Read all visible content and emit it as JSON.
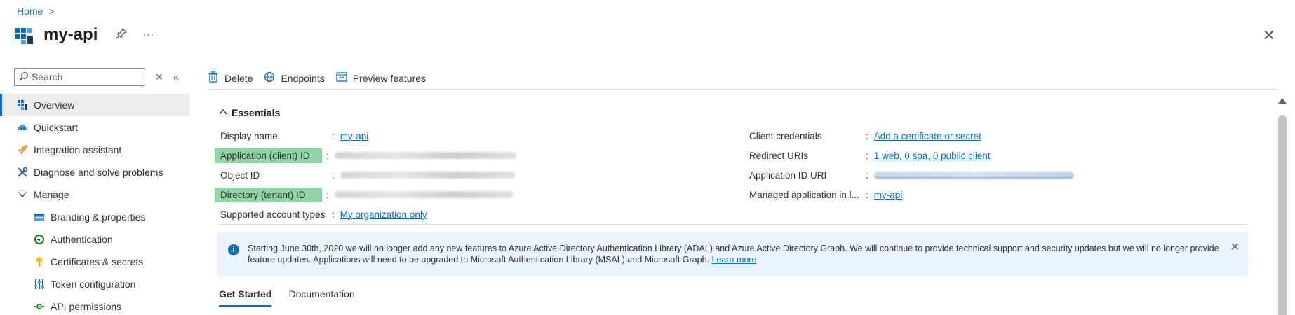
{
  "breadcrumb": {
    "home": "Home",
    "separator": ">"
  },
  "header": {
    "title": "my-api",
    "pin_icon": "pin-icon",
    "more": "···",
    "close": "✕"
  },
  "sidebar": {
    "search_placeholder": "Search",
    "clear_glyph": "✕",
    "collapse_glyph": "«",
    "items": [
      {
        "label": "Overview",
        "icon": "grid-icon"
      },
      {
        "label": "Quickstart",
        "icon": "cloud-icon"
      },
      {
        "label": "Integration assistant",
        "icon": "rocket-icon"
      },
      {
        "label": "Diagnose and solve problems",
        "icon": "wrench-icon"
      },
      {
        "label": "Manage",
        "icon": "chevron-down-icon"
      },
      {
        "label": "Branding & properties",
        "icon": "branding-icon"
      },
      {
        "label": "Authentication",
        "icon": "auth-icon"
      },
      {
        "label": "Certificates & secrets",
        "icon": "key-icon"
      },
      {
        "label": "Token configuration",
        "icon": "token-icon"
      },
      {
        "label": "API permissions",
        "icon": "permissions-icon"
      }
    ]
  },
  "toolbar": {
    "delete": "Delete",
    "endpoints": "Endpoints",
    "preview": "Preview features"
  },
  "essentials": {
    "title": "Essentials",
    "left": {
      "display_name_label": "Display name",
      "display_name_value": "my-api",
      "app_id_label": "Application (client) ID",
      "object_id_label": "Object ID",
      "directory_id_label": "Directory (tenant) ID",
      "supported_label": "Supported account types",
      "supported_value": "My organization only"
    },
    "right": {
      "client_cred_label": "Client credentials",
      "client_cred_value": "Add a certificate or secret",
      "redirect_label": "Redirect URIs",
      "redirect_value": "1 web, 0 spa, 0 public client",
      "app_id_uri_label": "Application ID URI",
      "managed_label": "Managed application in l...",
      "managed_value": "my-api"
    },
    "colon": ":"
  },
  "info": {
    "text": "Starting June 30th, 2020 we will no longer add any new features to Azure Active Directory Authentication Library (ADAL) and Azure Active Directory Graph. We will continue to provide technical support and security updates but we will no longer provide feature updates. Applications will need to be upgraded to Microsoft Authentication Library (MSAL) and Microsoft Graph.",
    "link": "Learn more",
    "close": "✕"
  },
  "tabs": [
    {
      "label": "Get Started"
    },
    {
      "label": "Documentation"
    }
  ],
  "colors": {
    "accent": "#0f6cbd",
    "highlight": "#8fd5a6",
    "info_bg": "#ebf3fc"
  }
}
